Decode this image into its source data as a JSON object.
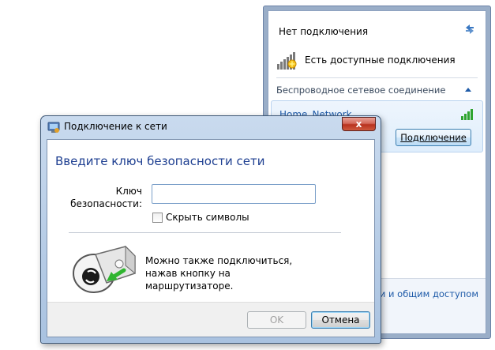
{
  "flyout": {
    "title": "Нет подключения",
    "status_text": "Есть доступные подключения",
    "section_label": "Беспроводное сетевое соединение",
    "network": {
      "name": "Home_Network",
      "connect_label": "Подключение"
    },
    "footer_link": "ми и общим доступом",
    "icons": [
      "refresh-icon",
      "no-connection-icon",
      "collapse-chevron-icon",
      "signal-strength-icon"
    ]
  },
  "dialog": {
    "title": "Подключение к сети",
    "close_label": "x",
    "heading": "Введите ключ безопасности сети",
    "key_label": "Ключ безопасности:",
    "key_value": "",
    "hide_chars_label": "Скрыть символы",
    "hide_chars_checked": false,
    "router_text": "Можно также подключиться, нажав кнопку на маршрутизаторе.",
    "ok_label": "OK",
    "cancel_label": "Отмена",
    "ok_enabled": false,
    "icons": [
      "network-window-icon",
      "router-push-button-icon"
    ]
  },
  "colors": {
    "heading_blue": "#1e3f91",
    "link_blue": "#1e5aa8",
    "close_red": "#b8321f",
    "signal_green": "#2fa42f"
  }
}
